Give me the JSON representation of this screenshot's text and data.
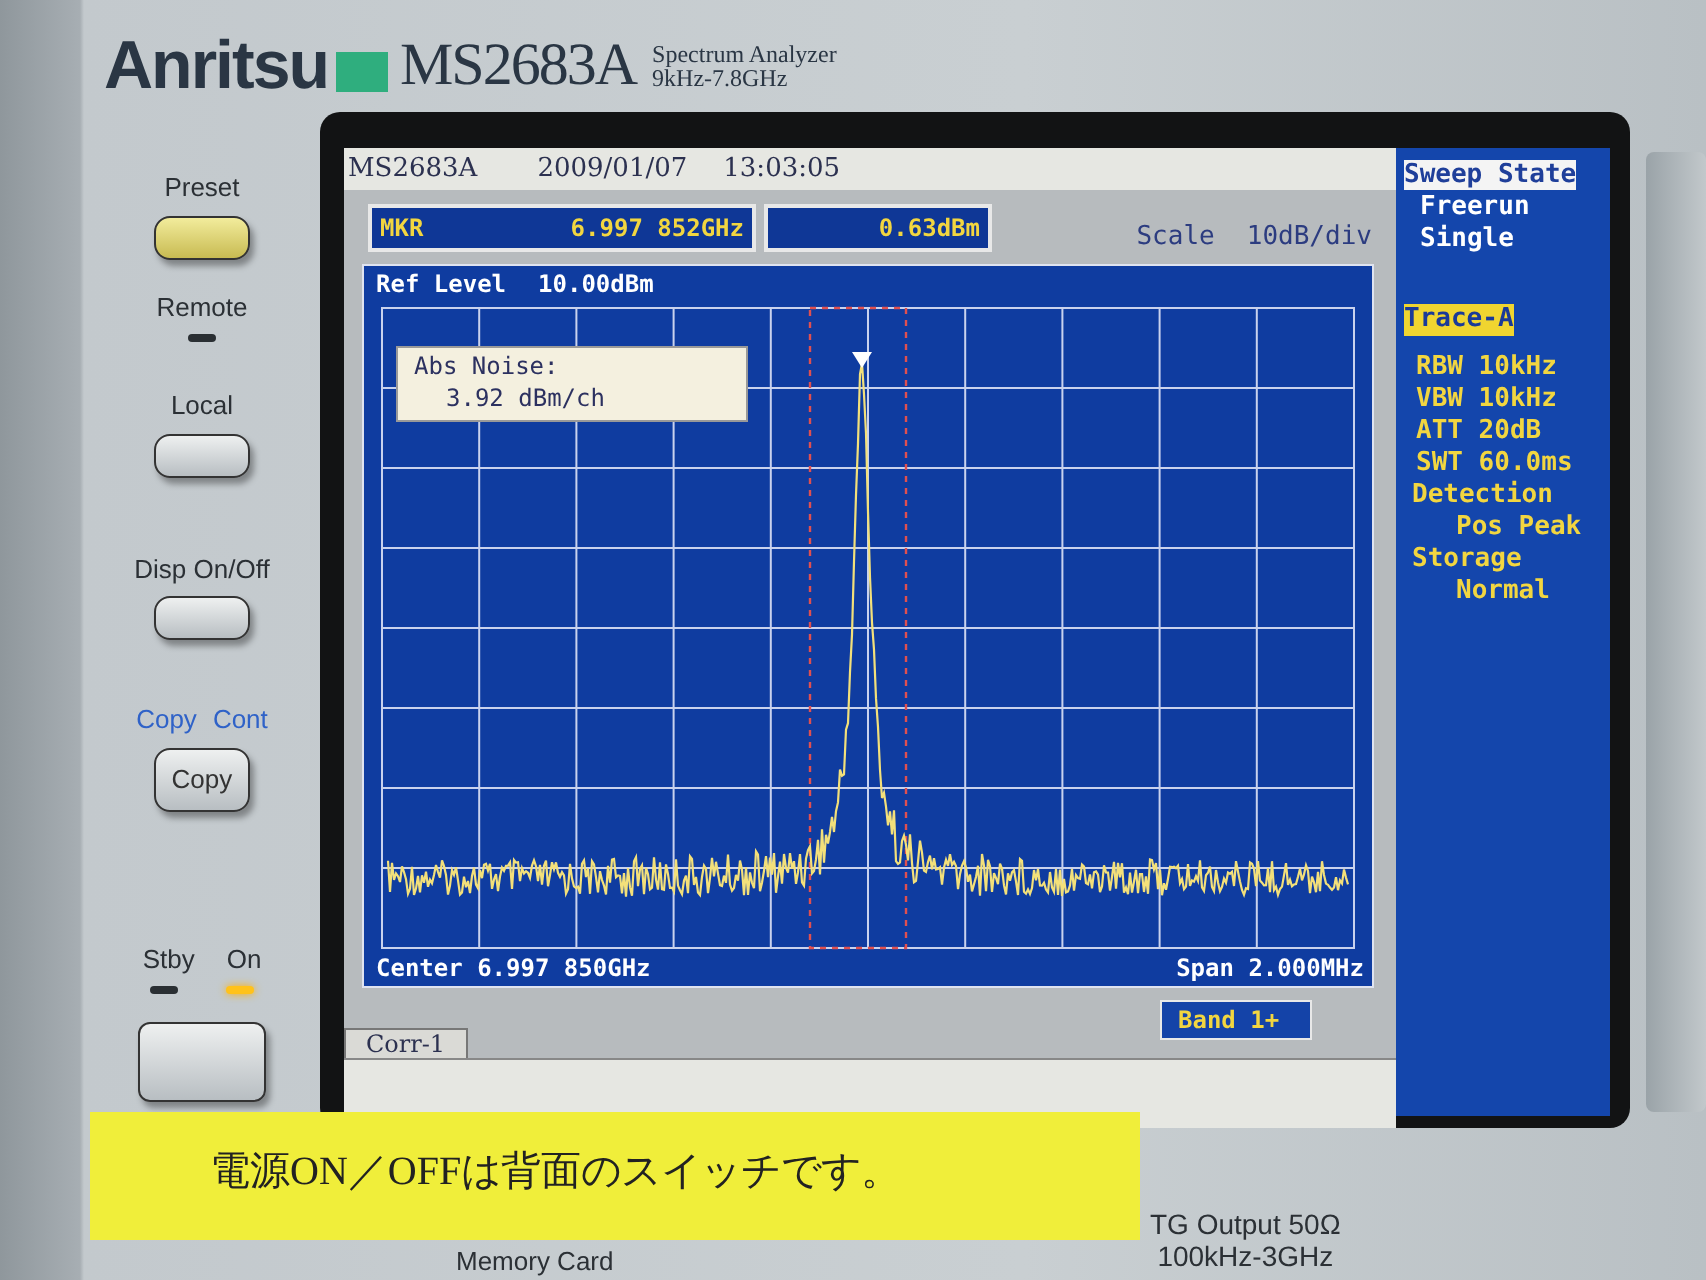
{
  "brand": {
    "logo": "Anritsu",
    "model": "MS2683A",
    "subtitle_line_1": "Spectrum Analyzer",
    "subtitle_line_2": "9kHz-7.8GHz"
  },
  "front_panel": {
    "controls": [
      {
        "kind": "button",
        "label": "Preset",
        "highlighted": true
      },
      {
        "kind": "indicator",
        "label": "Remote",
        "on": false
      },
      {
        "kind": "button",
        "label": "Local",
        "highlighted": false
      },
      {
        "kind": "button",
        "label": "Disp On/Off",
        "highlighted": false
      },
      {
        "kind": "shift_button",
        "shift_labels": [
          "Copy",
          "Cont"
        ],
        "caption": "Copy",
        "highlighted": false
      },
      {
        "kind": "power",
        "indicators": [
          {
            "label": "Stby",
            "on": false
          },
          {
            "label": "On",
            "on": true
          }
        ]
      }
    ]
  },
  "screen": {
    "status_bar": {
      "model": "MS2683A",
      "date": "2009/01/07",
      "time": "13:03:05"
    },
    "marker": {
      "label": "MKR",
      "frequency": "6.997 852GHz",
      "level": "0.63dBm"
    },
    "scale": {
      "label": "Scale",
      "value": "10dB/div"
    },
    "graph": {
      "ref_level_label": "Ref Level",
      "ref_level": "10.00dBm",
      "noise_box": {
        "title": "Abs Noise:",
        "value": "3.92 dBm/ch"
      },
      "center": "Center 6.997 850GHz",
      "span": "Span 2.000MHz"
    },
    "band": "Band 1+",
    "tab": "Corr-1",
    "side_panel": [
      {
        "kind": "header",
        "text": "Sweep State"
      },
      {
        "kind": "option",
        "text": "Freerun"
      },
      {
        "kind": "option",
        "text": "Single"
      },
      {
        "kind": "tag",
        "text": "Trace-A"
      },
      {
        "kind": "param",
        "text": "RBW 10kHz"
      },
      {
        "kind": "param",
        "text": "VBW 10kHz"
      },
      {
        "kind": "param",
        "text": "ATT 20dB"
      },
      {
        "kind": "param",
        "text": "SWT 60.0ms"
      },
      {
        "kind": "heading",
        "text": "Detection"
      },
      {
        "kind": "value",
        "text": "Pos Peak"
      },
      {
        "kind": "heading",
        "text": "Storage"
      },
      {
        "kind": "value",
        "text": "Normal"
      }
    ]
  },
  "sticker": "電源ON／OFFは背面のスイッチです。",
  "tg_output": [
    "TG Output 50Ω",
    "100kHz-3GHz"
  ],
  "memory_card": "Memory Card"
}
